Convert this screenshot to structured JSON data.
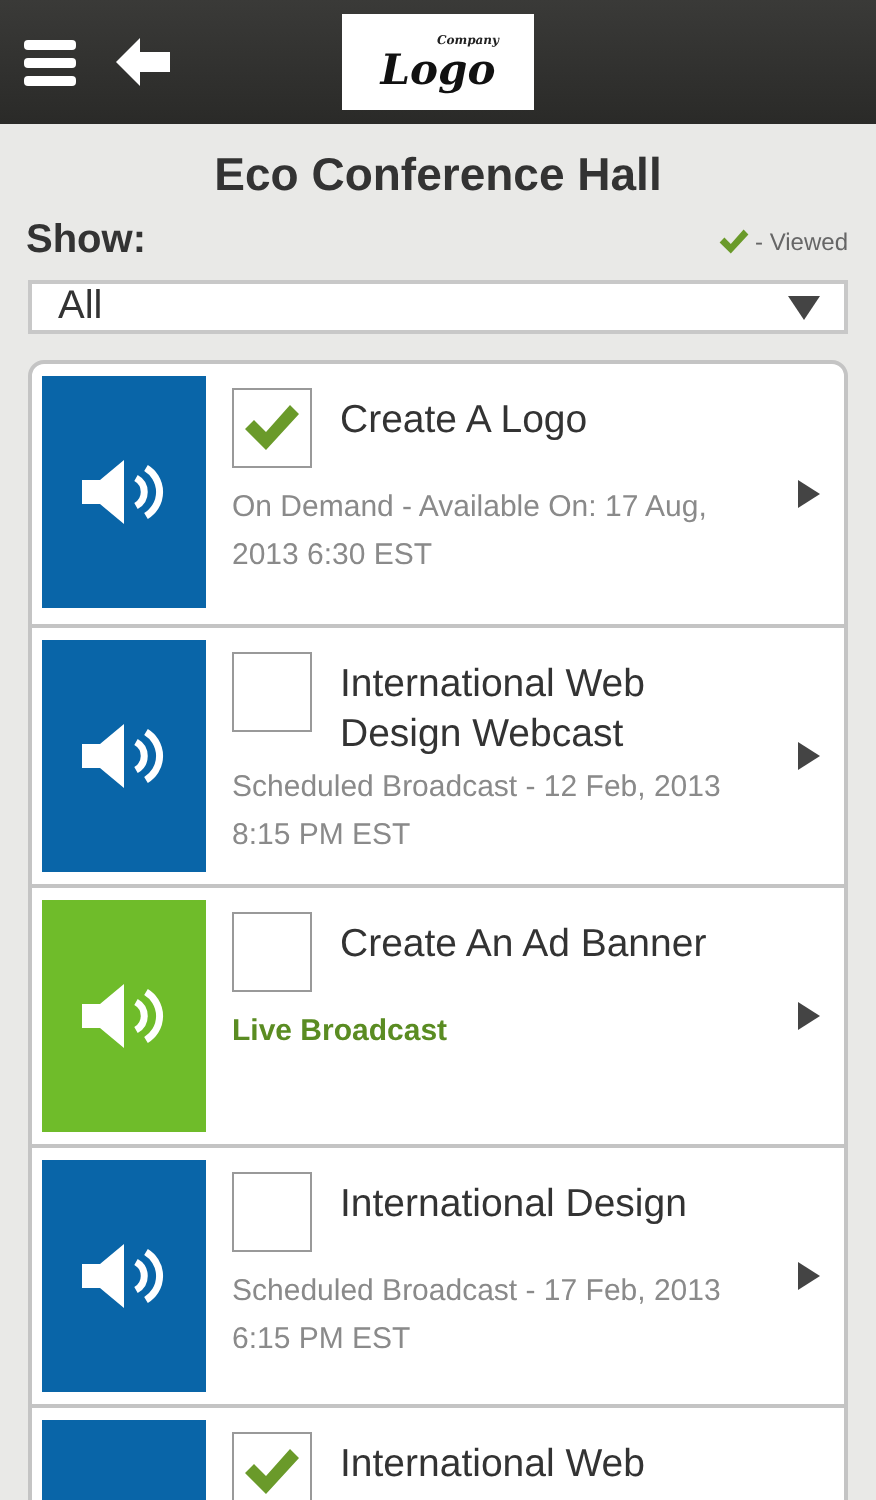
{
  "header": {
    "logo": {
      "small_text": "Company",
      "text": "Logo"
    }
  },
  "title": "Eco Conference Hall",
  "show_label": "Show:",
  "legend": "- Viewed",
  "filter": {
    "value": "All"
  },
  "sessions": [
    {
      "title": "Create A Logo",
      "kind": "on_demand",
      "checked": true,
      "detail": "On Demand - Available On: 17 Aug, 2013 6:30 EST"
    },
    {
      "title": "International Web Design Webcast",
      "kind": "scheduled",
      "checked": false,
      "detail": "Scheduled Broadcast - 12 Feb, 2013 8:15 PM EST"
    },
    {
      "title": "Create An Ad Banner",
      "kind": "live",
      "checked": false,
      "detail": "Live Broadcast"
    },
    {
      "title": "International Design",
      "kind": "scheduled",
      "checked": false,
      "detail": "Scheduled Broadcast - 17 Feb, 2013 6:15 PM EST"
    },
    {
      "title": "International Web",
      "kind": "scheduled",
      "checked": true
    }
  ]
}
